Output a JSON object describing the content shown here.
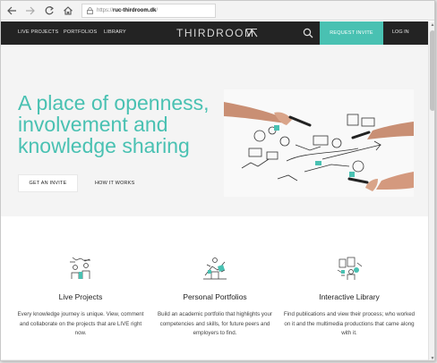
{
  "browser": {
    "url_protocol": "https://",
    "url_host": "ruc-thirdroom.dk",
    "url_path": "/"
  },
  "nav": {
    "links": [
      "LIVE PROJECTS",
      "PORTFOLIOS",
      "LIBRARY"
    ],
    "logo": "THIRDROOM",
    "request_invite": "REQUEST INVITE",
    "login": "LOG IN"
  },
  "hero": {
    "title_lines": [
      "A place of openness,",
      "involvement and",
      "knowledge sharing"
    ],
    "cta_primary": "GET AN INVITE",
    "cta_secondary": "HOW IT WORKS"
  },
  "features": [
    {
      "icon": "live-projects-illustration",
      "title": "Live Projects",
      "desc": "Every knowledge journey is unique. View, comment and collaborate on the projects that are LIVE right now."
    },
    {
      "icon": "personal-portfolios-illustration",
      "title": "Personal Portfolios",
      "desc": "Build an academic portfolio that highlights your competencies and skills, for future peers and employers to find."
    },
    {
      "icon": "interactive-library-illustration",
      "title": "Interactive Library",
      "desc": "Find publications and view their process; who worked on it and the multimedia productions that came along with it."
    }
  ],
  "colors": {
    "accent": "#49c1b2",
    "nav_bg": "#232323",
    "hero_bg": "#f4f4f4"
  }
}
